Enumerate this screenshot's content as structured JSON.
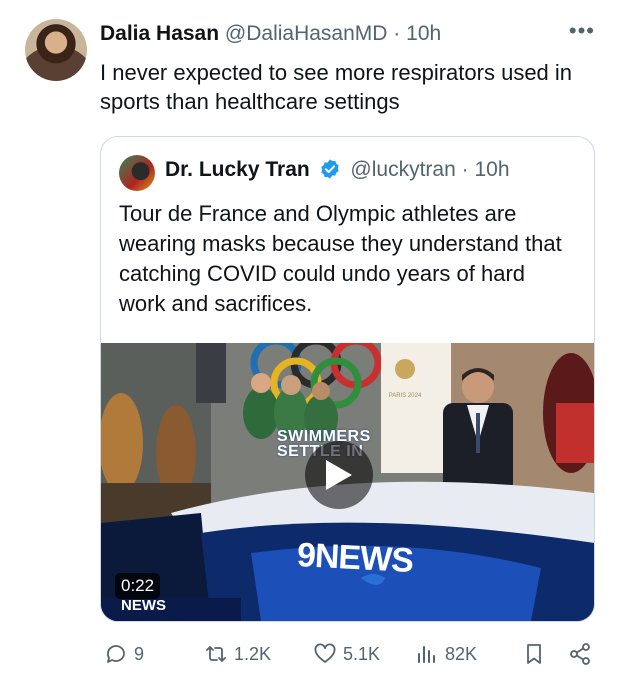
{
  "tweet": {
    "author_name": "Dalia Hasan",
    "author_handle": "@DaliaHasanMD",
    "separator": "·",
    "time": "10h",
    "more": "•••",
    "text": "I never expected to see more respirators used in sports than healthcare settings"
  },
  "quoted_tweet": {
    "author_name": "Dr. Lucky Tran",
    "author_handle": "@luckytran",
    "separator": "·",
    "time": "10h",
    "verified": true,
    "text": "Tour de France and Olympic athletes are wearing masks because they understand that catching COVID could undo years of hard work and sacrifices.",
    "video": {
      "duration": "0:22",
      "caption_line1": "SWIMMERS",
      "caption_line2": "SETTLE IN",
      "brand": "9NEWS",
      "brand_small": "NEWS",
      "paris_label": "PARIS 2024"
    }
  },
  "actions": {
    "replies": "9",
    "reposts": "1.2K",
    "likes": "5.1K",
    "views": "82K"
  },
  "colors": {
    "text": "#0f1419",
    "muted": "#536471",
    "verified": "#1d9bf0",
    "border": "#cfd9de"
  }
}
